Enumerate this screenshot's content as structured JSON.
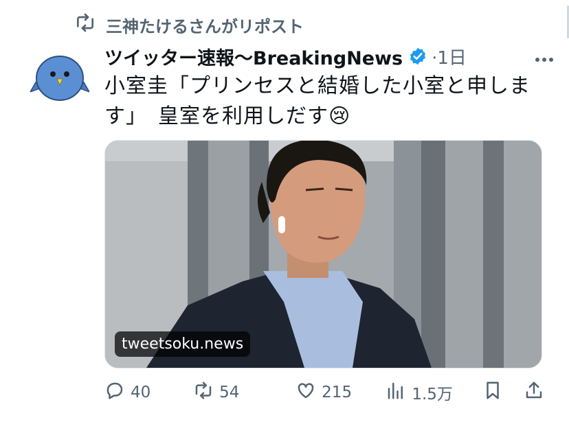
{
  "repost_context": {
    "text": "三神たけるさんがリポスト"
  },
  "tweet": {
    "author_name": "ツイッター速報〜BreakingNews",
    "time": "·1日",
    "text_line1": "小室圭「プリンセスと結婚した小室と申しま",
    "text_line2": "す」　皇室を利用しだす",
    "emoji": "😢",
    "media_watermark": "tweetsoku.news"
  },
  "actions": {
    "replies": "40",
    "reposts": "54",
    "likes": "215",
    "views": "1.5万"
  },
  "icons": {
    "repost": "repost-icon",
    "verified": "verified-badge-icon",
    "more": "more-icon",
    "reply": "reply-icon",
    "like": "heart-icon",
    "views": "views-icon",
    "bookmark": "bookmark-icon",
    "share": "share-icon"
  },
  "colors": {
    "accent": "#1d9bf0",
    "secondary_text": "#536471",
    "avatar_bird": "#5b8fd3"
  }
}
